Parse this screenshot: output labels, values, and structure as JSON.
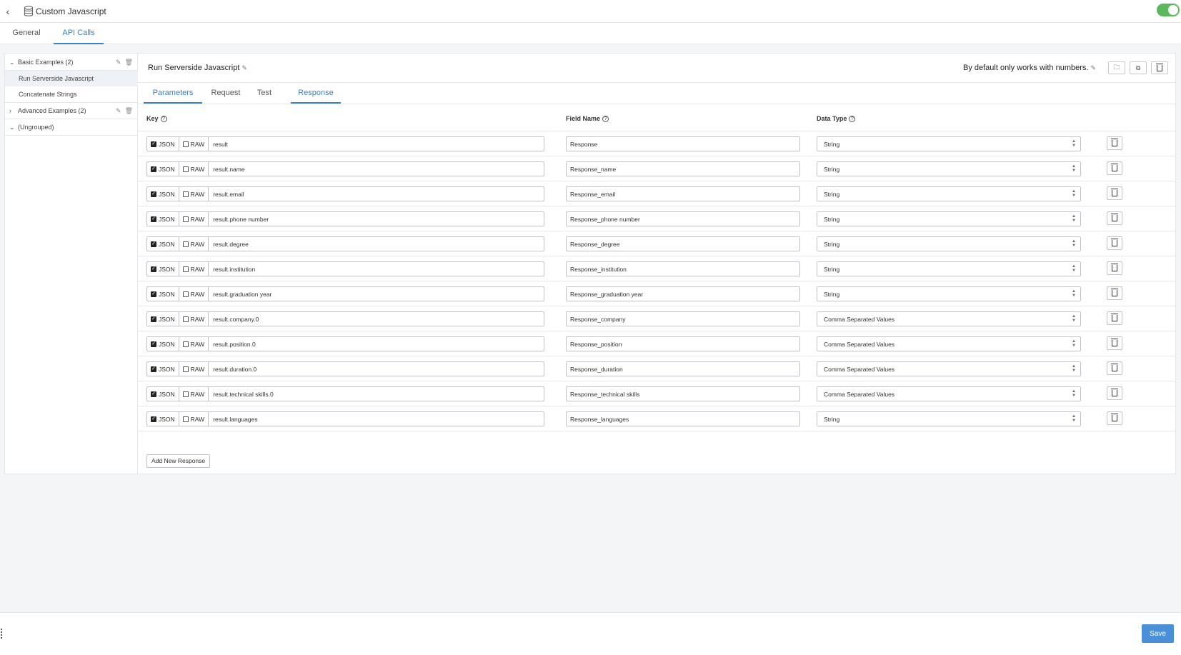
{
  "app": {
    "title": "Custom Javascript"
  },
  "main_tabs": [
    {
      "label": "General",
      "active": false
    },
    {
      "label": "API Calls",
      "active": true
    }
  ],
  "sidebar": {
    "groups": [
      {
        "label": "Basic Examples (2)",
        "expanded": true,
        "items": [
          "Run Serverside Javascript",
          "Concatenate Strings"
        ]
      },
      {
        "label": "Advanced Examples (2)",
        "expanded": false,
        "items": []
      },
      {
        "label": "(Ungrouped)",
        "expanded": true,
        "items": []
      }
    ],
    "selected_item": "Run Serverside Javascript"
  },
  "call": {
    "title": "Run Serverside Javascript",
    "description": "By default only works with numbers."
  },
  "sub_tabs": [
    {
      "label": "Parameters",
      "active": true
    },
    {
      "label": "Request",
      "active": false
    },
    {
      "label": "Test",
      "active": false
    },
    {
      "label": "Response",
      "active": true
    }
  ],
  "columns": {
    "key": "Key",
    "field_name": "Field Name",
    "data_type": "Data Type"
  },
  "checkbox_labels": {
    "json": "JSON",
    "raw": "RAW"
  },
  "rows": [
    {
      "key": "result",
      "field": "Response",
      "type": "String",
      "json": true,
      "raw": false
    },
    {
      "key": "result.name",
      "field": "Response_name",
      "type": "String",
      "json": true,
      "raw": false
    },
    {
      "key": "result.email",
      "field": "Response_email",
      "type": "String",
      "json": true,
      "raw": false
    },
    {
      "key": "result.phone number",
      "field": "Response_phone number",
      "type": "String",
      "json": true,
      "raw": false
    },
    {
      "key": "result.degree",
      "field": "Response_degree",
      "type": "String",
      "json": true,
      "raw": false
    },
    {
      "key": "result.institution",
      "field": "Response_institution",
      "type": "String",
      "json": true,
      "raw": false
    },
    {
      "key": "result.graduation year",
      "field": "Response_graduation year",
      "type": "String",
      "json": true,
      "raw": false
    },
    {
      "key": "result.company.0",
      "field": "Response_company",
      "type": "Comma Separated Values",
      "json": true,
      "raw": false
    },
    {
      "key": "result.position.0",
      "field": "Response_position",
      "type": "Comma Separated Values",
      "json": true,
      "raw": false
    },
    {
      "key": "result.duration.0",
      "field": "Response_duration",
      "type": "Comma Separated Values",
      "json": true,
      "raw": false
    },
    {
      "key": "result.technical skills.0",
      "field": "Response_technical skills",
      "type": "Comma Separated Values",
      "json": true,
      "raw": false
    },
    {
      "key": "result.languages",
      "field": "Response_languages",
      "type": "String",
      "json": true,
      "raw": false
    }
  ],
  "add_button_label": "Add New Response",
  "save_label": "Save",
  "colors": {
    "accent": "#3b7fc4",
    "toggle_on": "#5cb85c",
    "save": "#4a90d9"
  }
}
